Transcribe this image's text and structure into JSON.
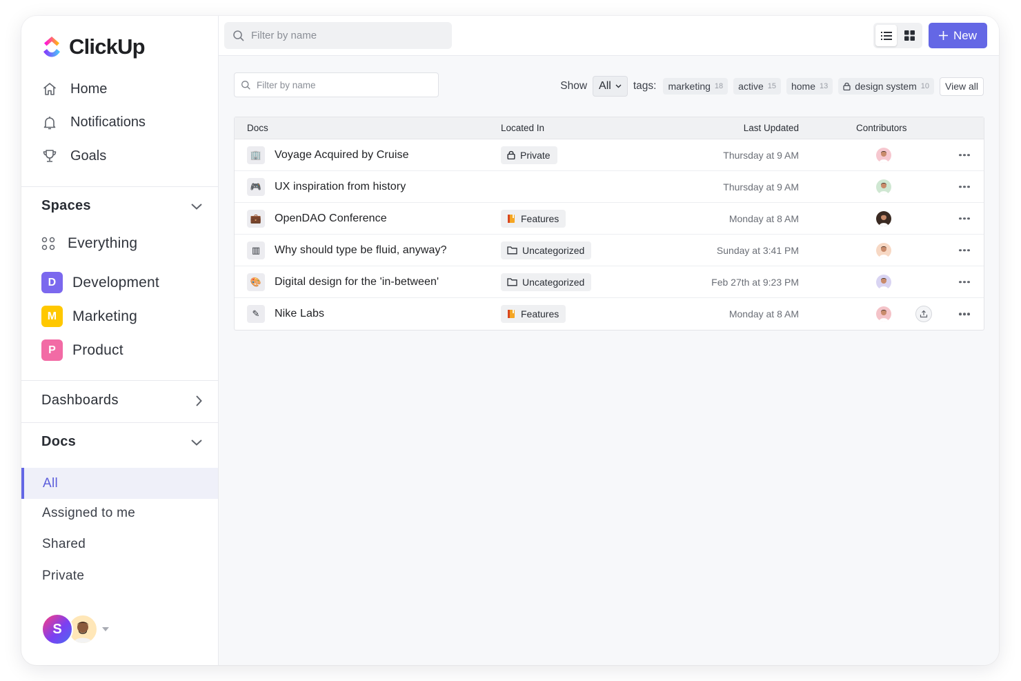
{
  "app": {
    "name": "ClickUp",
    "brand_color": "#7b68ee",
    "accent_color": "#6467e5"
  },
  "sidebar": {
    "nav": [
      {
        "label": "Home",
        "icon": "home-icon"
      },
      {
        "label": "Notifications",
        "icon": "bell-icon"
      },
      {
        "label": "Goals",
        "icon": "trophy-icon"
      }
    ],
    "spaces": {
      "title": "Spaces",
      "items": [
        {
          "label": "Everything",
          "icon": "grid-dots-icon"
        },
        {
          "label": "Development",
          "badge": "D",
          "color": "#7b68ee"
        },
        {
          "label": "Marketing",
          "badge": "M",
          "color": "#ffc800"
        },
        {
          "label": "Product",
          "badge": "P",
          "color": "#f26ba5"
        }
      ]
    },
    "dashboards": {
      "title": "Dashboards"
    },
    "docs": {
      "title": "Docs",
      "items": [
        {
          "label": "All",
          "active": true
        },
        {
          "label": "Assigned to me"
        },
        {
          "label": "Shared"
        },
        {
          "label": "Private"
        }
      ]
    },
    "user": {
      "initial": "S"
    }
  },
  "topbar": {
    "search_placeholder": "Filter by name",
    "new_label": "New"
  },
  "filters": {
    "search_placeholder": "Filter by name",
    "show_label": "Show",
    "show_value": "All",
    "tags_label": "tags:",
    "tags": [
      {
        "label": "marketing",
        "count": "18"
      },
      {
        "label": "active",
        "count": "15"
      },
      {
        "label": "home",
        "count": "13"
      },
      {
        "label": "design system",
        "count": "10",
        "locked": true
      }
    ],
    "view_all": "View all"
  },
  "table": {
    "headers": {
      "docs": "Docs",
      "located_in": "Located In",
      "last_updated": "Last Updated",
      "contributors": "Contributors"
    },
    "rows": [
      {
        "icon": "🏢",
        "name": "Voyage Acquired by Cruise",
        "location": "Private",
        "location_icon": "lock-icon",
        "updated": "Thursday at 9 AM",
        "avatar": "#f6c7cf"
      },
      {
        "icon": "🎮",
        "name": "UX inspiration from history",
        "location": "",
        "location_icon": "",
        "updated": "Thursday at 9 AM",
        "avatar": "#cfe7d2"
      },
      {
        "icon": "💼",
        "name": "OpenDAO Conference",
        "location": "Features",
        "location_icon": "book-icon",
        "updated": "Monday at 8 AM",
        "avatar": "#3a2a22"
      },
      {
        "icon": "▥",
        "name": "Why should type be fluid, anyway?",
        "location": "Uncategorized",
        "location_icon": "folder-icon",
        "updated": "Sunday at 3:41 PM",
        "avatar": "#f7d8c4"
      },
      {
        "icon": "🎨",
        "name": "Digital design for the 'in-between'",
        "location": "Uncategorized",
        "location_icon": "folder-icon",
        "updated": "Feb 27th at 9:23 PM",
        "avatar": "#d9d4f2"
      },
      {
        "icon": "✎",
        "name": "Nike Labs",
        "location": "Features",
        "location_icon": "book-icon",
        "updated": "Monday at 8 AM",
        "avatar": "#f4c3c8",
        "extra": true
      }
    ]
  }
}
